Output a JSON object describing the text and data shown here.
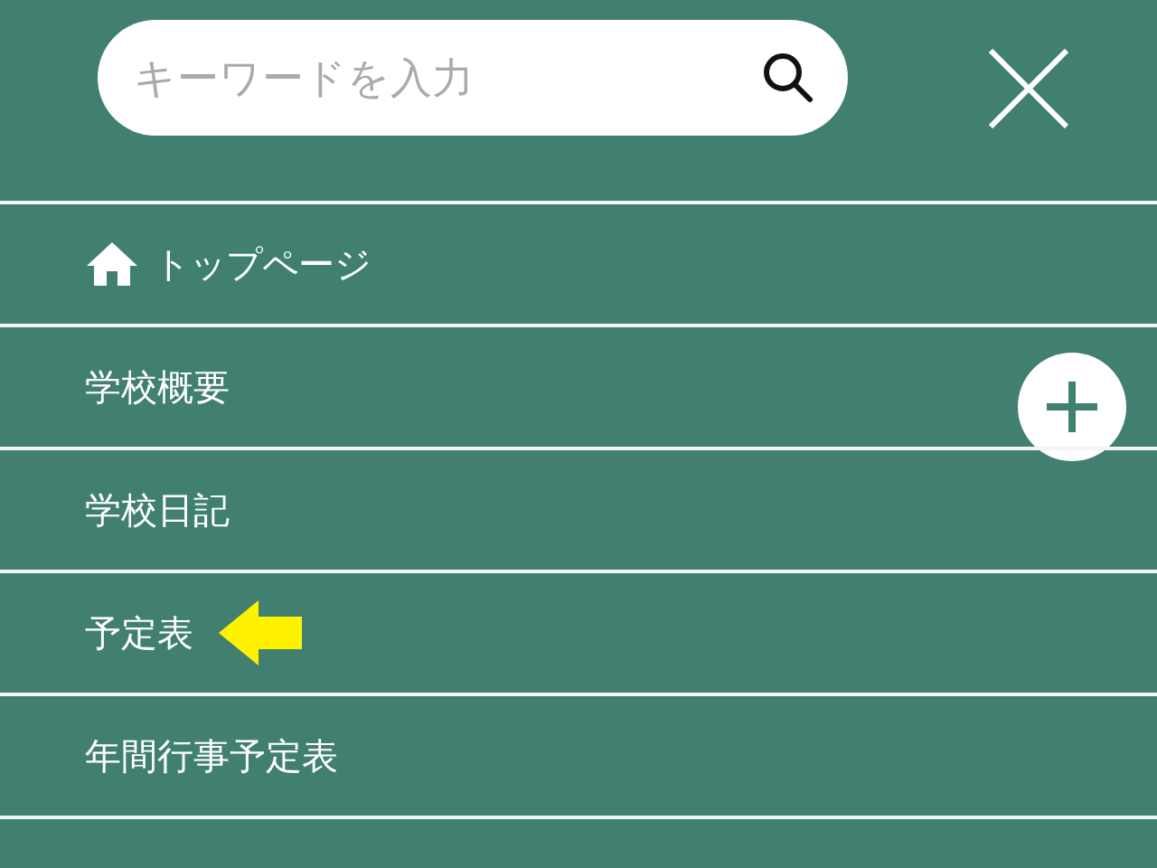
{
  "search": {
    "placeholder": "キーワードを入力"
  },
  "menu": [
    {
      "label": "トップページ",
      "kind": "home",
      "pointed": false
    },
    {
      "label": "学校概要",
      "kind": "group",
      "pointed": false
    },
    {
      "label": "学校日記",
      "kind": "page",
      "pointed": false
    },
    {
      "label": "予定表",
      "kind": "page",
      "pointed": true
    },
    {
      "label": "年間行事予定表",
      "kind": "page",
      "pointed": false
    }
  ]
}
